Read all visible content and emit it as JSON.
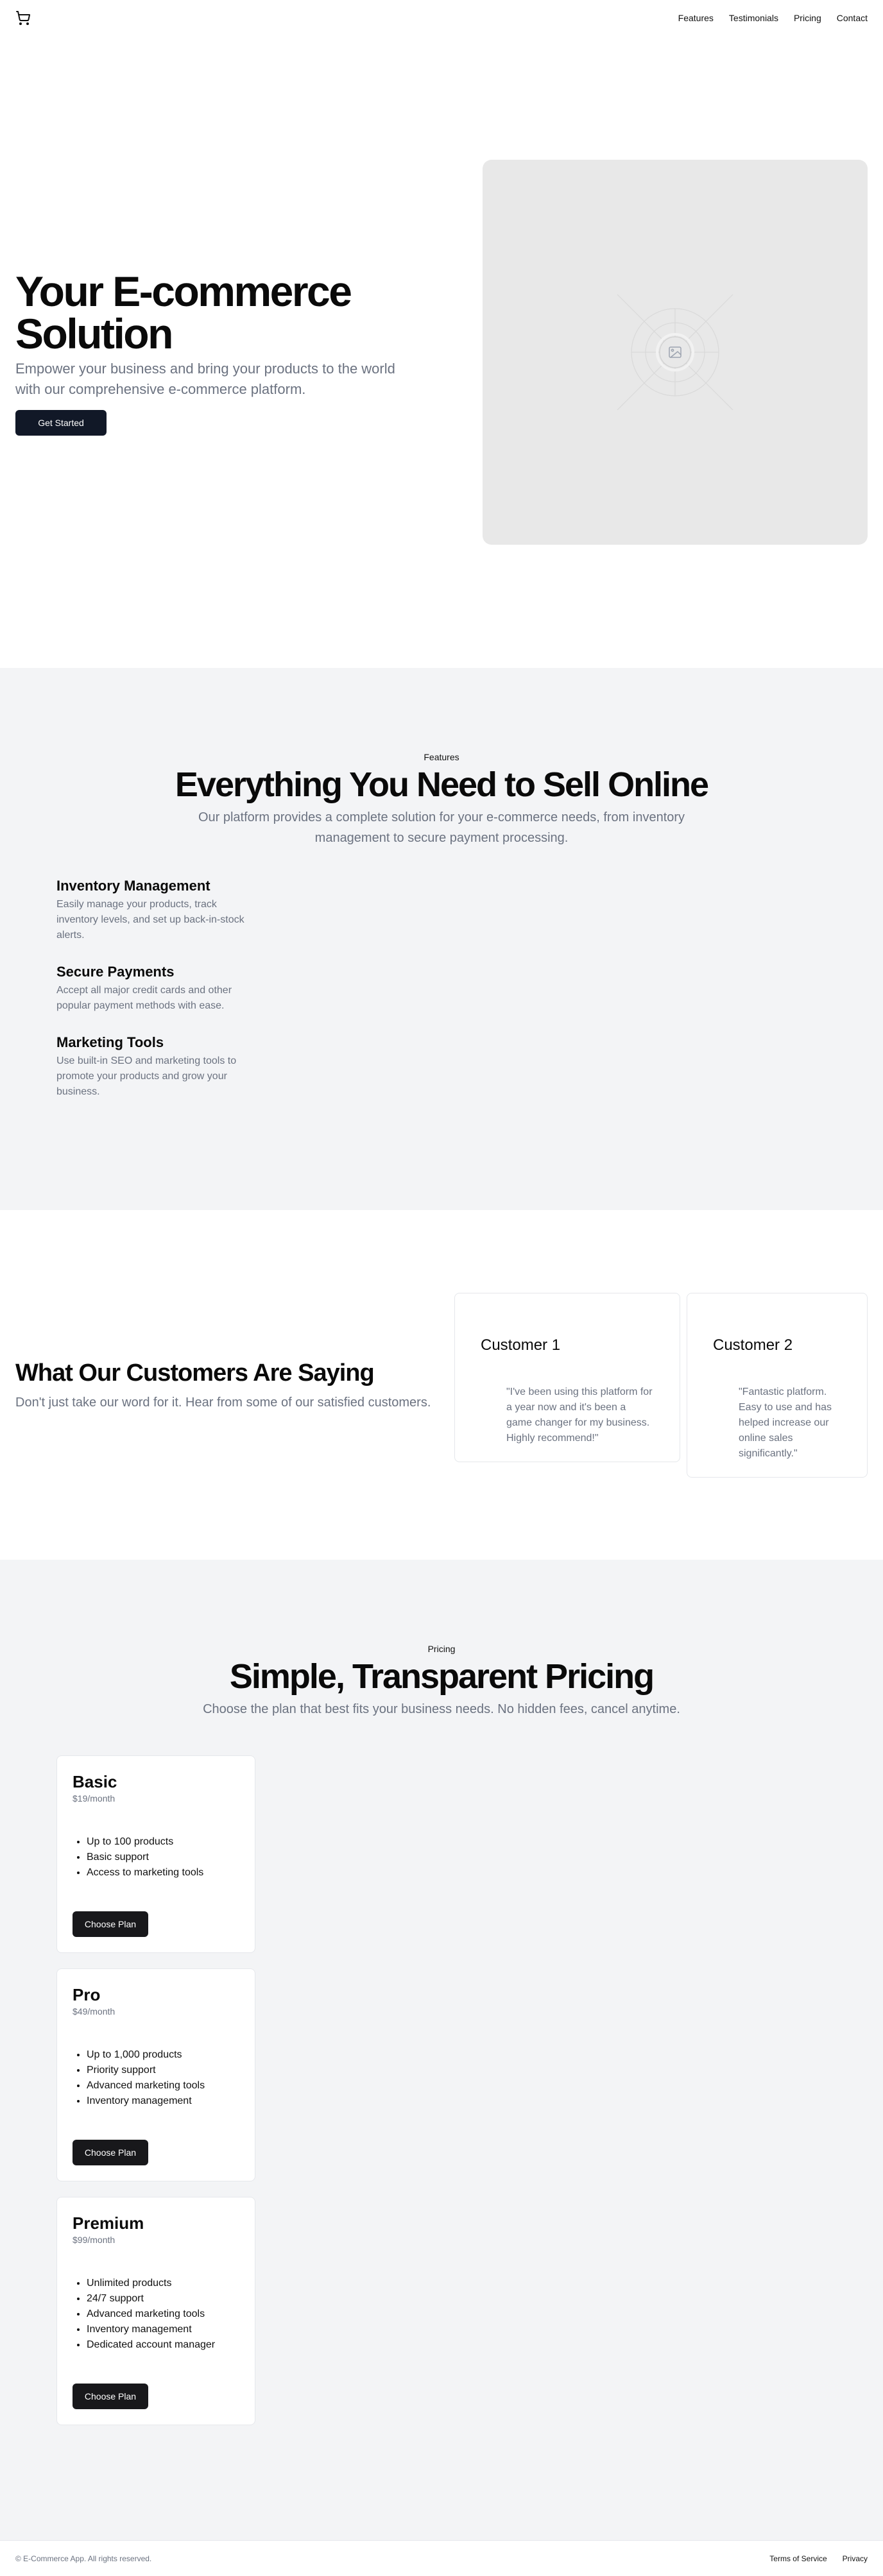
{
  "header": {
    "logo_icon": "shopping-cart-icon",
    "nav": [
      "Features",
      "Testimonials",
      "Pricing",
      "Contact"
    ]
  },
  "hero": {
    "title": "Your E-commerce Solution",
    "subtitle": "Empower your business and bring your products to the world with our comprehensive e-commerce platform.",
    "cta": "Get Started",
    "image_icon": "image-placeholder-icon"
  },
  "features": {
    "eyebrow": "Features",
    "title": "Everything You Need to Sell Online",
    "subtitle": "Our platform provides a complete solution for your e-commerce needs, from inventory management to secure payment processing.",
    "items": [
      {
        "title": "Inventory Management",
        "desc": "Easily manage your products, track inventory levels, and set up back-in-stock alerts."
      },
      {
        "title": "Secure Payments",
        "desc": "Accept all major credit cards and other popular payment methods with ease."
      },
      {
        "title": "Marketing Tools",
        "desc": "Use built-in SEO and marketing tools to promote your products and grow your business."
      }
    ]
  },
  "testimonials": {
    "title": "What Our Customers Are Saying",
    "subtitle": "Don't just take our word for it. Hear from some of our satisfied customers.",
    "items": [
      {
        "name": "Customer 1",
        "quote": "\"I've been using this platform for a year now and it's been a game changer for my business. Highly recommend!\""
      },
      {
        "name": "Customer 2",
        "quote": "\"Fantastic platform. Easy to use and has helped increase our online sales significantly.\""
      }
    ]
  },
  "pricing": {
    "eyebrow": "Pricing",
    "title": "Simple, Transparent Pricing",
    "subtitle": "Choose the plan that best fits your business needs. No hidden fees, cancel anytime.",
    "plans": [
      {
        "name": "Basic",
        "price": "$19/month",
        "features": [
          "Up to 100 products",
          "Basic support",
          "Access to marketing tools"
        ],
        "cta": "Choose Plan"
      },
      {
        "name": "Pro",
        "price": "$49/month",
        "features": [
          "Up to 1,000 products",
          "Priority support",
          "Advanced marketing tools",
          "Inventory management"
        ],
        "cta": "Choose Plan"
      },
      {
        "name": "Premium",
        "price": "$99/month",
        "features": [
          "Unlimited products",
          "24/7 support",
          "Advanced marketing tools",
          "Inventory management",
          "Dedicated account manager"
        ],
        "cta": "Choose Plan"
      }
    ]
  },
  "footer": {
    "copyright": "© E-Commerce App. All rights reserved.",
    "links": [
      "Terms of Service",
      "Privacy"
    ]
  }
}
